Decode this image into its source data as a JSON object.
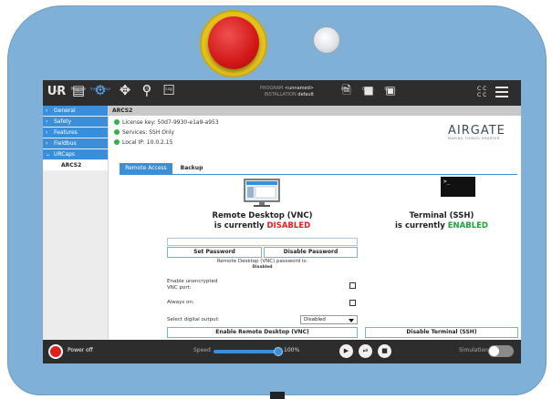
{
  "topbar": {
    "tabs": [
      {
        "label": "Run",
        "icon": "ur-logo-icon"
      },
      {
        "label": "Program",
        "icon": "program-icon"
      },
      {
        "label": "Installation",
        "icon": "installation-icon"
      },
      {
        "label": "Move",
        "icon": "move-icon"
      },
      {
        "label": "I/O",
        "icon": "io-icon"
      },
      {
        "label": "Log",
        "icon": "log-icon"
      }
    ],
    "program_label": "PROGRAM",
    "program_value": "<unnamed>",
    "installation_label": "INSTALLATION",
    "installation_value": "default",
    "new_label": "New...",
    "open_label": "Open...",
    "save_label": "Save...",
    "cc_top": "C  C",
    "cc_bottom": "C  C"
  },
  "sidebar": {
    "items": [
      {
        "label": "General"
      },
      {
        "label": "Safety"
      },
      {
        "label": "Features"
      },
      {
        "label": "Fieldbus"
      },
      {
        "label": "URCaps"
      }
    ],
    "subitem": "ARCS2"
  },
  "main": {
    "breadcrumb": "ARCS2",
    "license": "License key: 50d7-9930-e1a9-a953",
    "services": "Services: SSH Only",
    "local_ip": "Local IP: 10.0.2.15",
    "logo_main_left": "",
    "logo_main": "AIRGATE",
    "logo_tagline": "MAKING THINGS SMARTER",
    "tabs": [
      "Remote Access",
      "Backup"
    ],
    "vnc_title": "Remote Desktop (VNC)",
    "vnc_status_prefix": "is currently ",
    "vnc_status": "DISABLED",
    "ssh_title": "Terminal (SSH)",
    "ssh_status_prefix": "is currently ",
    "ssh_status": "ENABLED",
    "terminal_prompt": ">_",
    "set_password": "Set Password",
    "disable_password": "Disable Password",
    "password_info": "Remote Desktop (VNC) password is:",
    "password_state": "Disabled",
    "unencrypted_label_1": "Enable unencrypted",
    "unencrypted_label_2": "VNC port:",
    "always_on_label": "Always on:",
    "digital_output_label": "Select digital output:",
    "digital_output_value": "Disabled",
    "enable_vnc": "Enable Remote Desktop (VNC)",
    "disable_ssh": "Disable Terminal (SSH)"
  },
  "bottombar": {
    "power": "Power off",
    "speed_label": "Speed",
    "speed_value": "100%",
    "speed_fraction": 1.0,
    "simulation_label": "Simulation"
  },
  "colors": {
    "accent": "#3b8fd8",
    "disabled": "#e02020",
    "enabled": "#1da03a",
    "pendant": "#7eb0d8",
    "estop": "#d21818"
  }
}
